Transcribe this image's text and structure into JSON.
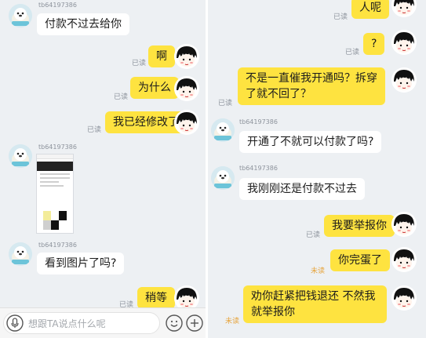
{
  "left": {
    "username_1": "tb64197386",
    "msg_1": "付款不过去给你",
    "msg_2": "啊",
    "read_2": "已读",
    "msg_3": "为什么",
    "read_3": "已读",
    "msg_4": "我已经修改了",
    "read_4": "已读",
    "username_2": "tb64197386",
    "username_3": "tb64197386",
    "msg_5": "看到图片了吗?",
    "msg_6": "稍等",
    "read_6": "已读",
    "input_placeholder": "想跟TA说点什么呢"
  },
  "right": {
    "msg_1": "人呢",
    "read_1": "已读",
    "msg_2": "?",
    "read_2": "已读",
    "msg_3": "不是一直催我开通吗？拆穿了就不回了？",
    "read_3": "已读",
    "username_1": "tb64197386",
    "msg_4": "开通了不就可以付款了吗?",
    "username_2": "tb64197386",
    "msg_5": "我刚刚还是付款不过去",
    "msg_6": "我要举报你",
    "read_6": "已读",
    "msg_7": "你完蛋了",
    "read_7": "未读",
    "msg_8": "劝你赶紧把钱退还 不然我就举报你",
    "read_8": "未读"
  },
  "colors": {
    "bubble_self": "#fee340",
    "bubble_other": "#ffffff",
    "background": "#edf0f3",
    "unread": "#e7a43c",
    "read": "#8d939c"
  },
  "icons": {
    "seal_avatar": "seal-avatar-icon",
    "girl_avatar": "girl-avatar-icon",
    "mic": "mic-icon",
    "emoji": "emoji-icon",
    "plus": "plus-icon"
  }
}
